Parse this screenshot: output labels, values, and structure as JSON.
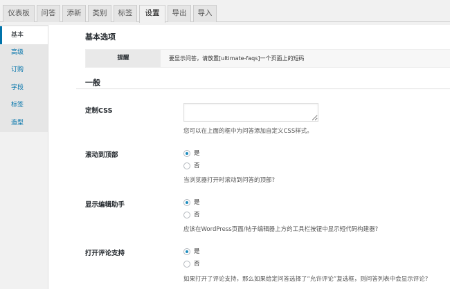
{
  "tabs": [
    {
      "label": "仪表板",
      "active": false
    },
    {
      "label": "问答",
      "active": false
    },
    {
      "label": "添新",
      "active": false
    },
    {
      "label": "类别",
      "active": false
    },
    {
      "label": "标签",
      "active": false
    },
    {
      "label": "设置",
      "active": true
    },
    {
      "label": "导出",
      "active": false
    },
    {
      "label": "导入",
      "active": false
    }
  ],
  "sidebar": {
    "items": [
      {
        "label": "基本",
        "active": true
      },
      {
        "label": "高级",
        "active": false
      },
      {
        "label": "订购",
        "active": false
      },
      {
        "label": "字段",
        "active": false
      },
      {
        "label": "标签",
        "active": false
      },
      {
        "label": "造型",
        "active": false
      }
    ]
  },
  "main": {
    "section_basic": "基本选项",
    "notice": {
      "label": "提醒",
      "text": "要显示问答，请放置[ultimate-faqs]一个页面上的短码"
    },
    "section_general": "一般",
    "custom_css": {
      "label": "定制CSS",
      "value": "",
      "description": "您可以在上面的框中为问答添加自定义CSS样式。"
    },
    "scroll_top": {
      "label": "滚动到顶部",
      "options": [
        {
          "label": "是",
          "checked": true
        },
        {
          "label": "否",
          "checked": false
        }
      ],
      "description": "当浏览器打开时滚动到问答的顶部?"
    },
    "editor_helper": {
      "label": "显示编辑助手",
      "options": [
        {
          "label": "是",
          "checked": true
        },
        {
          "label": "否",
          "checked": false
        }
      ],
      "description": "应该在WordPress页面/帖子编辑器上方的工具栏按钮中显示短代码构建器?"
    },
    "comments": {
      "label": "打开评论支持",
      "options": [
        {
          "label": "是",
          "checked": true
        },
        {
          "label": "否",
          "checked": false
        }
      ],
      "description": "如果打开了评论支持，那么如果给定问答选择了“允许评论”复选框，则问答列表中会显示评论?"
    }
  },
  "colors": {
    "accent": "#0073aa",
    "radio_checked": "#1e8cbe"
  }
}
